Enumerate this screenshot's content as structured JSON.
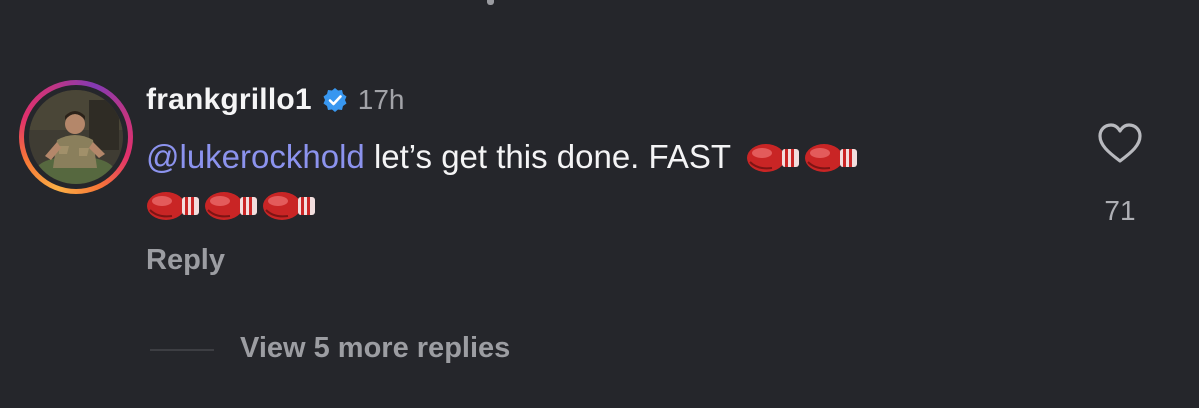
{
  "comment": {
    "username": "frankgrillo1",
    "verified": true,
    "timestamp": "17h",
    "mention": "@lukerockhold",
    "text": " let’s get this done.  FAST ",
    "emojis_line1": [
      "boxing-glove",
      "boxing-glove"
    ],
    "emojis_line2": [
      "boxing-glove",
      "boxing-glove",
      "boxing-glove"
    ],
    "reply_label": "Reply",
    "like_count": "71",
    "view_more_label": "View 5 more replies"
  },
  "colors": {
    "background": "#25262b",
    "mention": "#8c93ee",
    "verified_badge": "#3897f0",
    "muted_text": "#9c9da2"
  },
  "icons": {
    "avatar": "profile-photo",
    "badge": "verified-badge-icon",
    "like": "heart-outline-icon"
  }
}
